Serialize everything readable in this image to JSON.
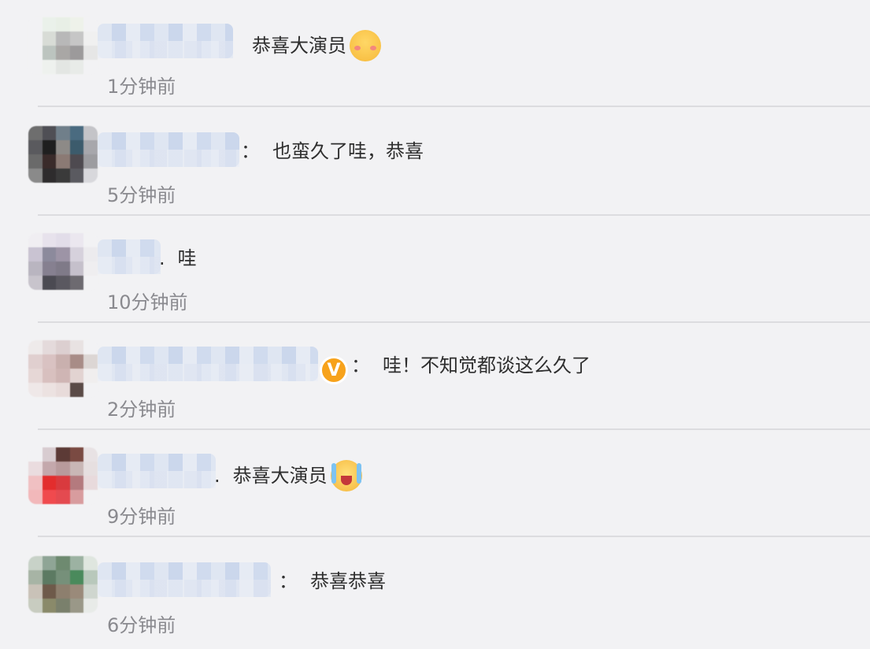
{
  "comments": [
    {
      "separator": "",
      "text": "恭喜大演员",
      "emoji": "blushing-face-emoji",
      "time": "1分钟前",
      "avatar_colors": [
        "#f2f2f4",
        "#eaf1ea",
        "#e8efe6",
        "#eef2ea",
        "#f2f2f4",
        "#f2f2f4",
        "#d8dcd6",
        "#b8b8b8",
        "#c6c6c6",
        "#f0f0f0",
        "#f2f2f4",
        "#bcc4bf",
        "#a9a7a5",
        "#9c9a9b",
        "#e6e6e6",
        "#f2f2f4",
        "#eef1ee",
        "#e3e6e3",
        "#e8ebe8",
        "#f2f2f4"
      ]
    },
    {
      "separator": "：",
      "text": "也蛮久了哇，恭喜",
      "emoji": "",
      "time": "5分钟前",
      "avatar_colors": [
        "#6e6e6e",
        "#4f4f55",
        "#707f8a",
        "#4a6b80",
        "#c4c4c8",
        "#5a5a5e",
        "#1f1f1f",
        "#8d8a87",
        "#3c5b6c",
        "#a7a7ac",
        "#6a6a6a",
        "#3a2b2a",
        "#8b7a74",
        "#4e4a50",
        "#9c9ca0",
        "#8a8a8a",
        "#2e2c2d",
        "#3a3a3a",
        "#5a5a60",
        "#d8d8dc"
      ]
    },
    {
      "separator": ".",
      "text": "哇",
      "emoji": "",
      "time": "10分钟前",
      "avatar_colors": [
        "#f0eef2",
        "#e7e2ec",
        "#e2dde9",
        "#ebe7ef",
        "#f2f2f4",
        "#c9c3d2",
        "#8c8a9c",
        "#9d94a6",
        "#d6d1dc",
        "#ecebee",
        "#b9b5c0",
        "#868090",
        "#7f7a88",
        "#c5c0cb",
        "#efeef0",
        "#c8c4cc",
        "#4b4a52",
        "#5a5860",
        "#6d6a70",
        "#f2f2f4"
      ]
    },
    {
      "separator": "：",
      "text": "哇！不知觉都谈这么久了",
      "emoji": "",
      "time": "2分钟前",
      "avatar_colors": [
        "#eeeaea",
        "#e4dadb",
        "#dccfd0",
        "#e8e2e2",
        "#f2f2f4",
        "#e0cfcf",
        "#d9c2c2",
        "#c9b0ae",
        "#a88c87",
        "#dcd6d4",
        "#e6d7d6",
        "#d8c0bf",
        "#cfb5b4",
        "#e2d3d1",
        "#f0eeee",
        "#efe8e8",
        "#ece2e1",
        "#e8dbda",
        "#5a4a46",
        "#f2f2f4"
      ]
    },
    {
      "separator": ".",
      "text": "恭喜大演员",
      "emoji": "crying-laughing-emoji",
      "time": "9分钟前",
      "avatar_colors": [
        "#f2f2f4",
        "#d8ccd0",
        "#5c3a36",
        "#7a4a42",
        "#e8e2e4",
        "#eadcdf",
        "#c4a8ac",
        "#b89a9c",
        "#c9b7b6",
        "#e6dfe0",
        "#f0c0c2",
        "#e32d2d",
        "#d93a3e",
        "#b47a7e",
        "#e8dadc",
        "#f2b8ba",
        "#f04a4e",
        "#e44a50",
        "#d89c9e",
        "#f2f2f4"
      ]
    },
    {
      "separator": "：",
      "text": "恭喜恭喜",
      "emoji": "",
      "time": "6分钟前",
      "avatar_colors": [
        "#c8d2c8",
        "#8fa596",
        "#6e8a70",
        "#9cb2a2",
        "#dfe6df",
        "#a7b4a5",
        "#5c7a62",
        "#76907a",
        "#4a8a5c",
        "#b8c8bb",
        "#c9c2b8",
        "#6e5a4a",
        "#8d7f6e",
        "#9a8a7a",
        "#cfd6cf",
        "#c8ccc0",
        "#8a8a6a",
        "#7a806c",
        "#9a9888",
        "#e8ebe8"
      ]
    }
  ]
}
